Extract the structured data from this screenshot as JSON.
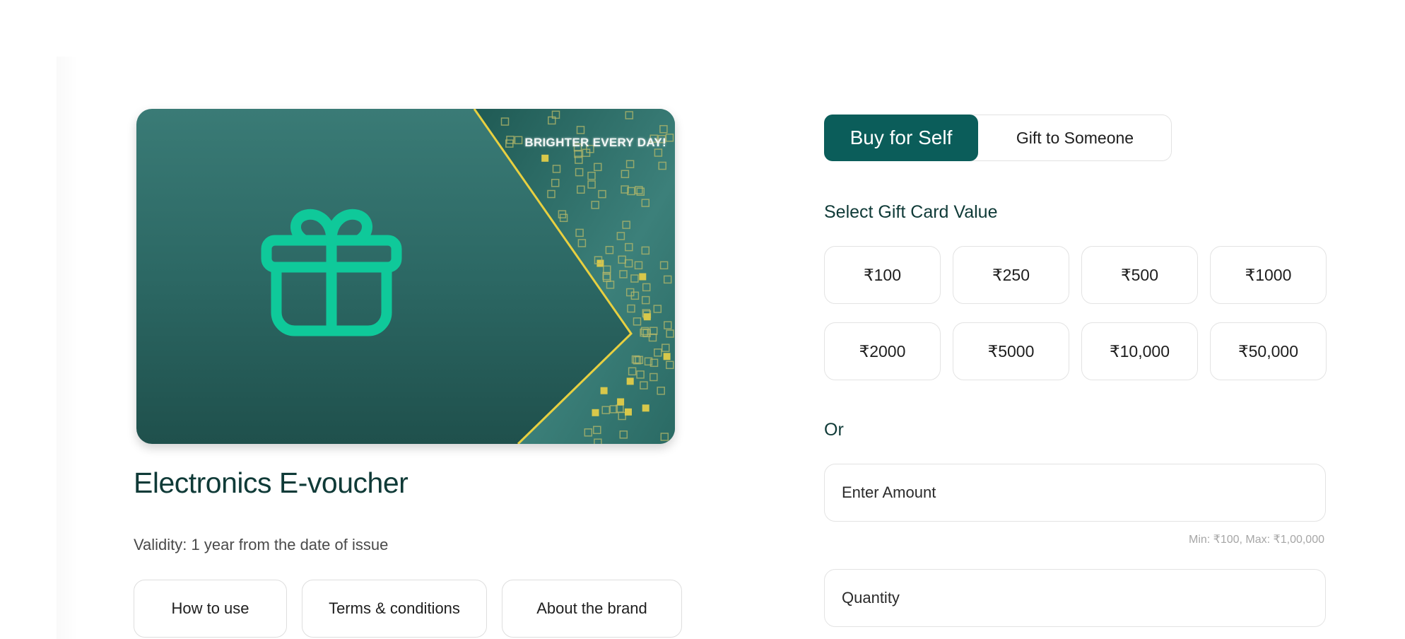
{
  "card": {
    "slogan": "BRIGHTER EVERY DAY!",
    "colors": {
      "primary": "#2c6864",
      "gift_icon": "#0fc99a",
      "gold": "#e8d040"
    }
  },
  "product": {
    "title": "Electronics E-voucher",
    "validity": "Validity: 1 year from the date of issue"
  },
  "info_tabs": [
    "How to use",
    "Terms & conditions",
    "About the brand"
  ],
  "purchase_toggle": {
    "self_label": "Buy for Self",
    "gift_label": "Gift to Someone",
    "selected": "Buy for Self"
  },
  "values_section": {
    "title": "Select Gift Card Value",
    "options": [
      "₹100",
      "₹250",
      "₹500",
      "₹1000",
      "₹2000",
      "₹5000",
      "₹10,000",
      "₹50,000"
    ]
  },
  "or_label": "Or",
  "amount_field": {
    "placeholder": "Enter Amount",
    "hint": "Min: ₹100, Max: ₹1,00,000"
  },
  "quantity_field": {
    "placeholder": "Quantity"
  },
  "accent_color": "#0b5d5a"
}
